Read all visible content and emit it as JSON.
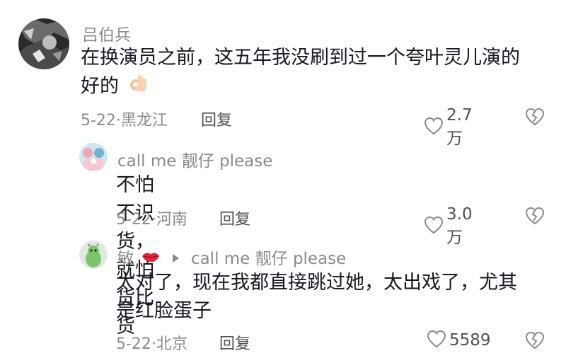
{
  "comments": [
    {
      "username": "吕伯兵",
      "text_line1": "在换演员之前，这五年我没刷到过一个夸叶灵儿演的",
      "text_line2": "好的",
      "emoji": "ok-hand",
      "date_location": "5-22·黑龙江",
      "reply_label": "回复",
      "likes": "2.7万"
    },
    {
      "username": "call me 靓仔 please",
      "text": "不怕不识货，就怕货比货",
      "date_location": "5-22·河南",
      "reply_label": "回复",
      "likes": "3.0万"
    },
    {
      "username": "敏",
      "username_emoji": "lips",
      "reply_to": "call me 靓仔 please",
      "text_line1": "太对了，现在我都直接跳过她，太出戏了，尤其",
      "text_line2": "是红脸蛋子",
      "date_location": "5-22·北京",
      "reply_label": "回复",
      "likes": "5589"
    }
  ],
  "colors": {
    "primary_text": "#161823",
    "secondary_text": "#8a8b91",
    "action_text": "#505258",
    "background": "#ffffff"
  }
}
